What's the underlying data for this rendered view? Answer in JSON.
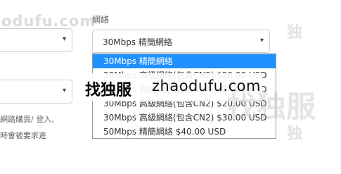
{
  "watermark": {
    "top_left": "odufu.com",
    "overlay_cn": "找独服",
    "overlay_domain": "zhaodufu.com",
    "big_cn": "找独服",
    "right_edge": "独",
    "right_edge_bottom": "独"
  },
  "left_panel": {
    "note_line_1": "網路購買/ 登入,",
    "note_line_2": "時會被要求進"
  },
  "form": {
    "field_label": "網絡",
    "selected_value": "30Mbps 精簡網絡",
    "options": [
      "30Mbps 精簡網絡",
      "20Mbps 高級網絡(包含CN2) $20.00 USD",
      "20Mbps 高級網絡(包含CN2) $20.00 USD",
      "30Mbps 高級網絡(包含CN2) $20.00 USD",
      "30Mbps 高級網絡(包含CN2) $30.00 USD",
      "50Mbps 精簡網絡 $40.00 USD"
    ],
    "caret": "▾"
  },
  "icons": {
    "caret": "chevron-down-icon"
  }
}
